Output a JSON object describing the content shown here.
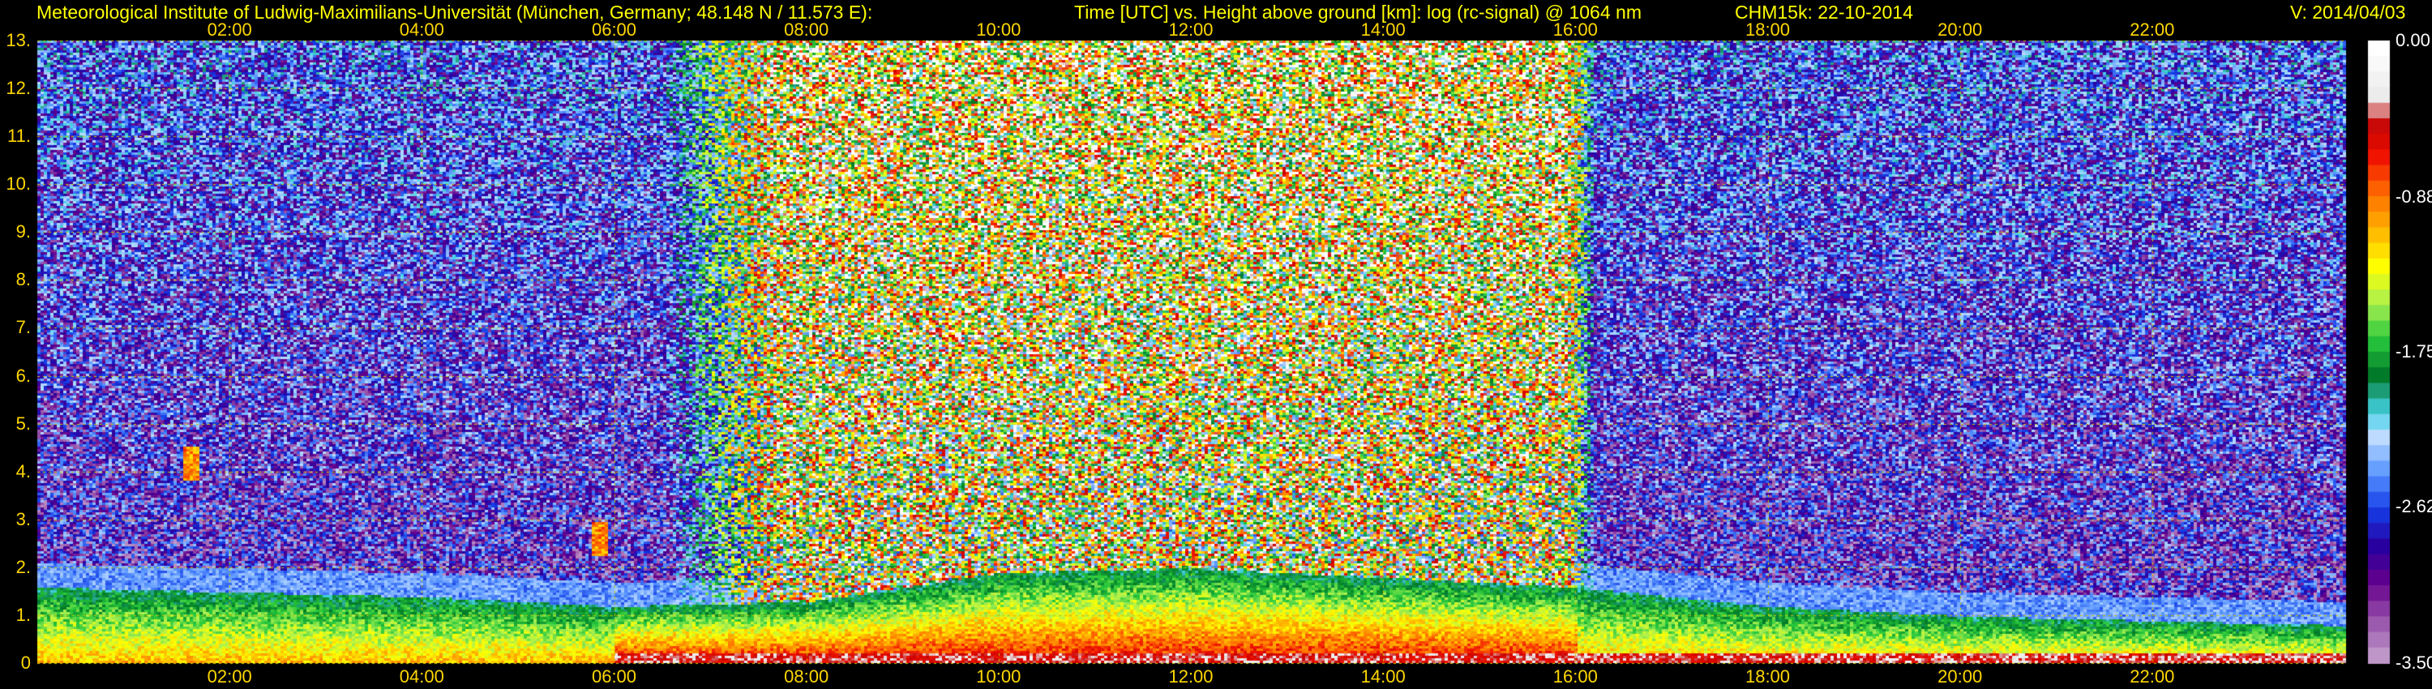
{
  "header": {
    "institute": "Meteorological Institute of Ludwig-Maximilians-Universität (München, Germany; 48.148 N / 11.573 E):",
    "title": "Time [UTC] vs. Height above ground [km]: log (rc-signal) @ 1064 nm",
    "instrument": "CHM15k: 22-10-2014",
    "version": "V: 2014/04/03"
  },
  "colors": {
    "header_text": "#ffff00",
    "tick_text": "#ffd700",
    "grid": "#c8c800"
  },
  "chart_data": {
    "type": "heatmap",
    "title": "Time [UTC] vs. Height above ground [km]: log (rc-signal) @ 1064 nm",
    "x_axis": {
      "label": "Time [UTC]",
      "range_hours": [
        0,
        24
      ],
      "ticks": [
        "02:00",
        "04:00",
        "06:00",
        "08:00",
        "10:00",
        "12:00",
        "14:00",
        "16:00",
        "18:00",
        "20:00",
        "22:00"
      ]
    },
    "y_axis": {
      "label": "Height above ground [km]",
      "range_km": [
        0,
        13
      ],
      "ticks": [
        "0",
        "1.",
        "2.",
        "3.",
        "4.",
        "5.",
        "6.",
        "7.",
        "8.",
        "9.",
        "10.",
        "11.",
        "12.",
        "13."
      ]
    },
    "colorbar": {
      "label": "log (rc-signal)",
      "range": [
        -3.5,
        0.0
      ],
      "ticks": [
        "0.00",
        "-0.88",
        "-1.75",
        "-2.62",
        "-3.50"
      ]
    },
    "grid": true,
    "features": {
      "boundary_layer_top_km": [
        1.6,
        1.5,
        1.4,
        1.2,
        1.3,
        1.9,
        2.0,
        1.8,
        1.6,
        1.2,
        1.0,
        0.9,
        0.8
      ],
      "cloud_events": [
        {
          "time": "01:35",
          "height_km": 4.2
        },
        {
          "time": "05:50",
          "height_km": 2.6
        }
      ],
      "daytime_background": [
        "07:00",
        "16:00"
      ]
    }
  }
}
